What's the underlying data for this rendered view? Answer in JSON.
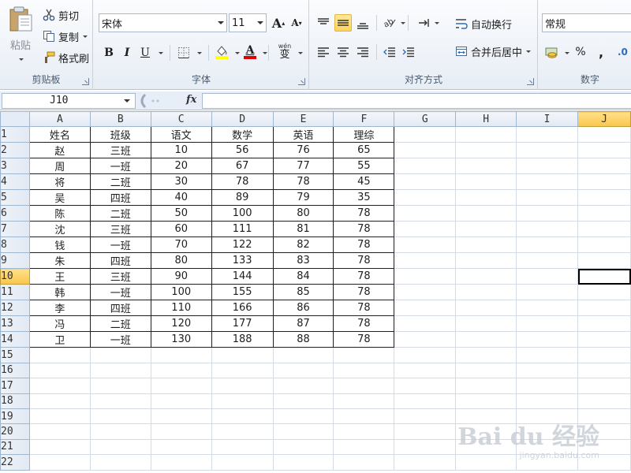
{
  "ribbon": {
    "clipboard": {
      "label": "剪贴板",
      "paste_label": "粘贴",
      "cut_label": "剪切",
      "copy_label": "复制",
      "format_painter_label": "格式刷"
    },
    "font": {
      "label": "字体",
      "font_name": "宋体",
      "font_size": "11",
      "bold": "B",
      "italic": "I",
      "underline": "U",
      "grow": "A",
      "shrink": "A",
      "font_color": "A",
      "phonetic": "wén",
      "phonetic_char": "变"
    },
    "alignment": {
      "label": "对齐方式",
      "wrap_text_label": "自动换行",
      "merge_center_label": "合并后居中"
    },
    "number": {
      "label": "数字",
      "format_value": "常规",
      "percent": "%",
      "comma": ",",
      "increase_decimal": ".0"
    }
  },
  "formula_bar": {
    "name_box": "J10",
    "fx_label": "fx",
    "formula": ""
  },
  "sheet": {
    "columns": [
      "A",
      "B",
      "C",
      "D",
      "E",
      "F",
      "G",
      "H",
      "I",
      "J"
    ],
    "selected_column": "J",
    "selected_row": 10,
    "row_count": 22,
    "header": [
      "姓名",
      "班级",
      "语文",
      "数学",
      "英语",
      "理综"
    ],
    "rows": [
      [
        "赵",
        "三班",
        "10",
        "56",
        "76",
        "65"
      ],
      [
        "周",
        "一班",
        "20",
        "67",
        "77",
        "55"
      ],
      [
        "将",
        "二班",
        "30",
        "78",
        "78",
        "45"
      ],
      [
        "吴",
        "四班",
        "40",
        "89",
        "79",
        "35"
      ],
      [
        "陈",
        "二班",
        "50",
        "100",
        "80",
        "78"
      ],
      [
        "沈",
        "三班",
        "60",
        "111",
        "81",
        "78"
      ],
      [
        "钱",
        "一班",
        "70",
        "122",
        "82",
        "78"
      ],
      [
        "朱",
        "四班",
        "80",
        "133",
        "83",
        "78"
      ],
      [
        "王",
        "三班",
        "90",
        "144",
        "84",
        "78"
      ],
      [
        "韩",
        "一班",
        "100",
        "155",
        "85",
        "78"
      ],
      [
        "李",
        "四班",
        "110",
        "166",
        "86",
        "78"
      ],
      [
        "冯",
        "二班",
        "120",
        "177",
        "87",
        "78"
      ],
      [
        "卫",
        "一班",
        "130",
        "188",
        "88",
        "78"
      ]
    ]
  },
  "watermark": {
    "main": "Bai du 经验",
    "sub": "jingyan.baidu.com"
  },
  "colors": {
    "ribbon_bg": "#e7edf5",
    "header_bg": "#e2e9f3",
    "selected_header": "#f9c64c",
    "active_tool": "#ffd45b",
    "gridline": "#d4dbe5"
  }
}
